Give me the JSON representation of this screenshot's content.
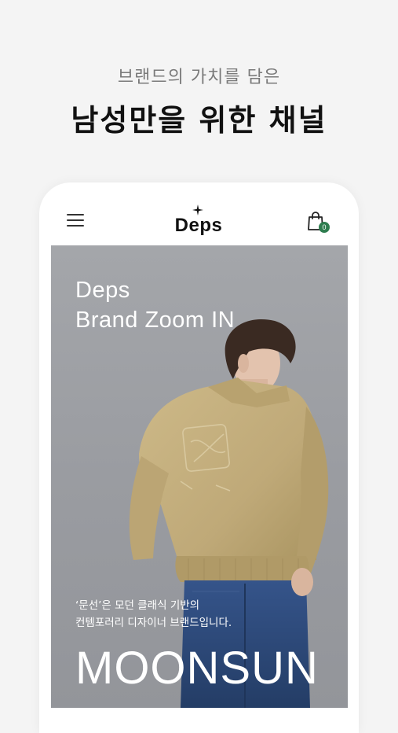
{
  "promo": {
    "subtitle": "브랜드의 가치를 담은",
    "title": "남성만을 위한 채널"
  },
  "appbar": {
    "menu_icon": "hamburger-menu-icon",
    "logo": "Deps",
    "cart_icon": "shopping-bag-icon",
    "cart_count": "0"
  },
  "hero": {
    "title_line1": "Deps",
    "title_line2": "Brand Zoom IN",
    "desc_line1": "‘문선’은 모던 클래식 기반의",
    "desc_line2": "컨템포러리 디자이너 브랜드입니다.",
    "brand": "MOONSUN"
  },
  "colors": {
    "background": "#f4f4f4",
    "hero_bg": "#9a9ca1",
    "badge": "#2e7d4f",
    "jacket": "#c2ae7c",
    "jeans": "#2f4a78"
  }
}
